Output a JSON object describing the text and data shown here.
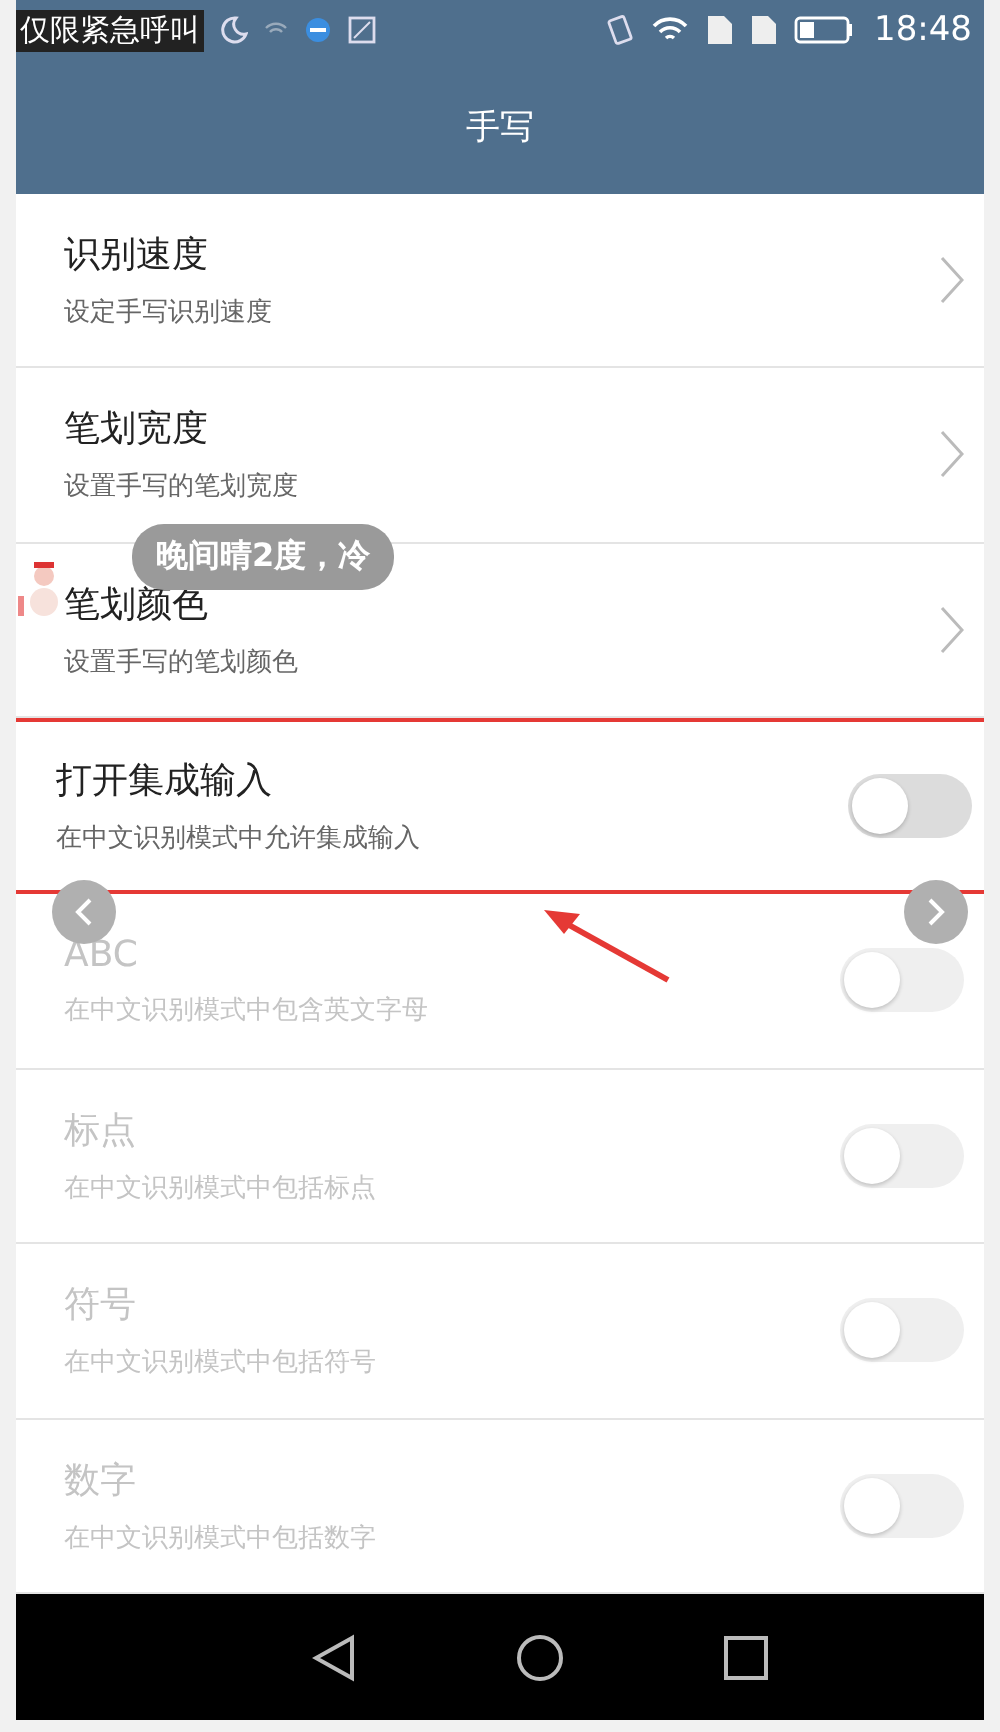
{
  "status_bar": {
    "carrier": "仅限紧急呼叫",
    "time": "18:48"
  },
  "header": {
    "title": "手写"
  },
  "settings": [
    {
      "kind": "link",
      "title": "识别速度",
      "subtitle": "设定手写识别速度",
      "disabled": false
    },
    {
      "kind": "link",
      "title": "笔划宽度",
      "subtitle": "设置手写的笔划宽度",
      "disabled": false
    },
    {
      "kind": "link",
      "title": "笔划颜色",
      "subtitle": "设置手写的笔划颜色",
      "disabled": false
    },
    {
      "kind": "toggle",
      "title": "打开集成输入",
      "subtitle": "在中文识别模式中允许集成输入",
      "disabled": false,
      "on": false,
      "highlighted": true
    },
    {
      "kind": "toggle",
      "title": "ABC",
      "subtitle": "在中文识别模式中包含英文字母",
      "disabled": true,
      "on": false
    },
    {
      "kind": "toggle",
      "title": "标点",
      "subtitle": "在中文识别模式中包括标点",
      "disabled": true,
      "on": false
    },
    {
      "kind": "toggle",
      "title": "符号",
      "subtitle": "在中文识别模式中包括符号",
      "disabled": true,
      "on": false
    },
    {
      "kind": "toggle",
      "title": "数字",
      "subtitle": "在中文识别模式中包括数字",
      "disabled": true,
      "on": false
    }
  ],
  "toast": {
    "text": "晚间晴2度，冷"
  }
}
